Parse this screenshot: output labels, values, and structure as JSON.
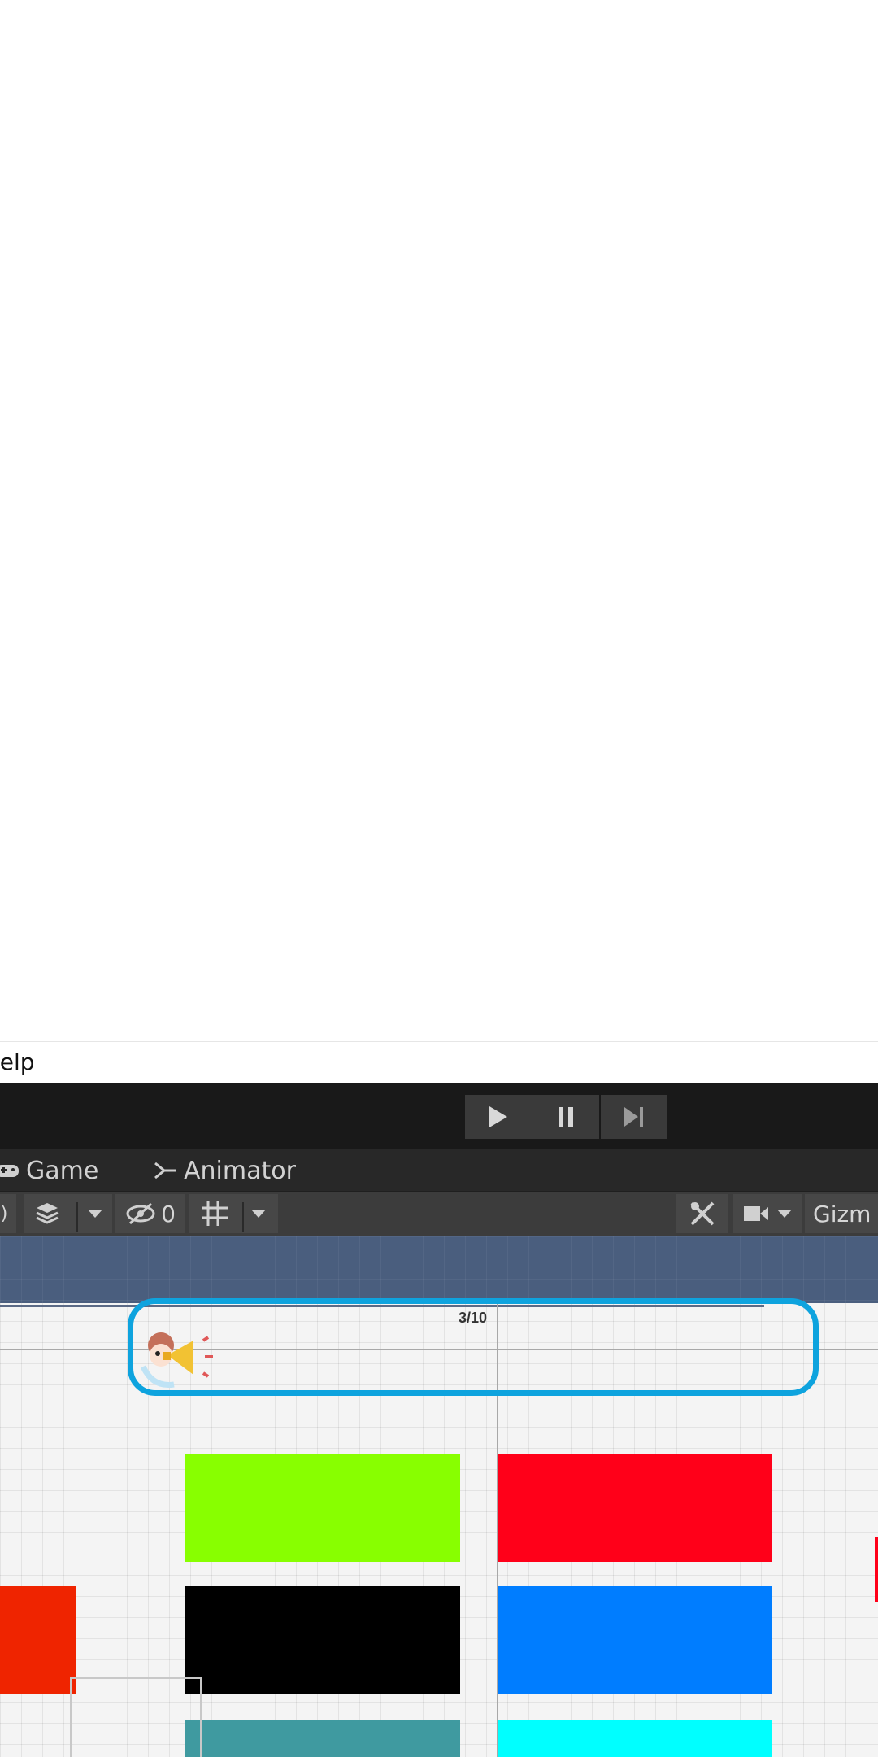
{
  "menubar": {
    "help_label": "lelp"
  },
  "playbar": {
    "play": "play-icon",
    "pause": "pause-icon",
    "step": "step-icon"
  },
  "tabs": [
    {
      "label": "Game",
      "icon": "gamepad-icon"
    },
    {
      "label": "Animator",
      "icon": "animator-icon"
    }
  ],
  "toolbar": {
    "hidden_count": "0",
    "gizmos_label": "Gizm"
  },
  "scene": {
    "progress": {
      "text": "3/10",
      "current": 3,
      "total": 10
    },
    "swatches": [
      {
        "name": "green",
        "color": "#88ff00"
      },
      {
        "name": "red",
        "color": "#ff0019"
      },
      {
        "name": "black",
        "color": "#000000"
      },
      {
        "name": "blue",
        "color": "#007dff"
      },
      {
        "name": "teal",
        "color": "#3f9aa0"
      },
      {
        "name": "cyan",
        "color": "#00ffff"
      },
      {
        "name": "orange-red",
        "color": "#ef2400"
      }
    ]
  }
}
